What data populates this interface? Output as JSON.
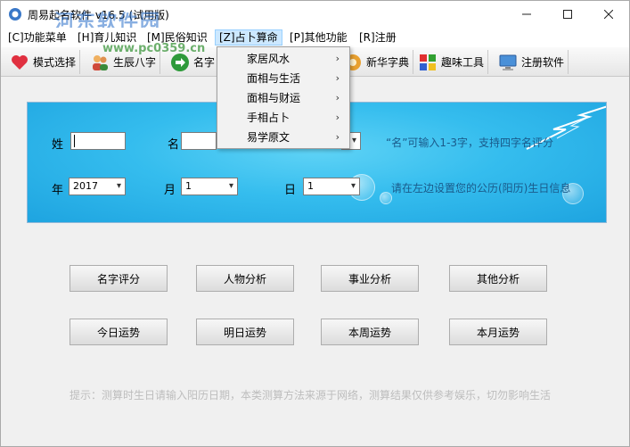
{
  "window": {
    "title": "周易起名软件 v16.5 (试用版)",
    "watermark": "河东软件园",
    "watermark_url": "www.pc0359.cn"
  },
  "menubar": {
    "items": [
      {
        "label": "[C]功能菜单"
      },
      {
        "label": "[H]育儿知识"
      },
      {
        "label": "[M]民俗知识"
      },
      {
        "label": "[Z]占卜算命"
      },
      {
        "label": "[P]其他功能"
      },
      {
        "label": "[R]注册"
      }
    ]
  },
  "toolbar": {
    "items": [
      {
        "label": "模式选择",
        "icon": "heart-icon"
      },
      {
        "label": "生辰八字",
        "icon": "people-icon"
      },
      {
        "label": "名字",
        "icon": "arrow-right-icon"
      },
      {
        "label": "新华字典",
        "icon": "dictionary-icon"
      },
      {
        "label": "趣味工具",
        "icon": "puzzle-icon"
      },
      {
        "label": "注册软件",
        "icon": "monitor-icon"
      }
    ]
  },
  "dropdown": {
    "items": [
      {
        "label": "家居风水"
      },
      {
        "label": "面相与生活"
      },
      {
        "label": "面相与财运"
      },
      {
        "label": "手相占卜"
      },
      {
        "label": "易学原文"
      }
    ],
    "arrow": "›"
  },
  "form": {
    "surname_label": "姓",
    "name_label": "名",
    "name_hint": "“名”可输入1-3字，支持四字名评分",
    "year_label": "年",
    "year_value": "2017",
    "month_label": "月",
    "month_value": "1",
    "day_label": "日",
    "day_value": "1",
    "date_hint": "请在左边设置您的公历(阳历)生日信息"
  },
  "actions": {
    "row1": [
      "名字评分",
      "人物分析",
      "事业分析",
      "其他分析"
    ],
    "row2": [
      "今日运势",
      "明日运势",
      "本周运势",
      "本月运势"
    ]
  },
  "footer": {
    "tip": "提示：测算时生日请输入阳历日期，本类测算方法来源于网络，测算结果仅供参考娱乐，切勿影响生活"
  },
  "colors": {
    "panel_blue": "#35bdee",
    "menu_highlight": "#cce8ff",
    "hint_text": "#1a5a8a"
  }
}
